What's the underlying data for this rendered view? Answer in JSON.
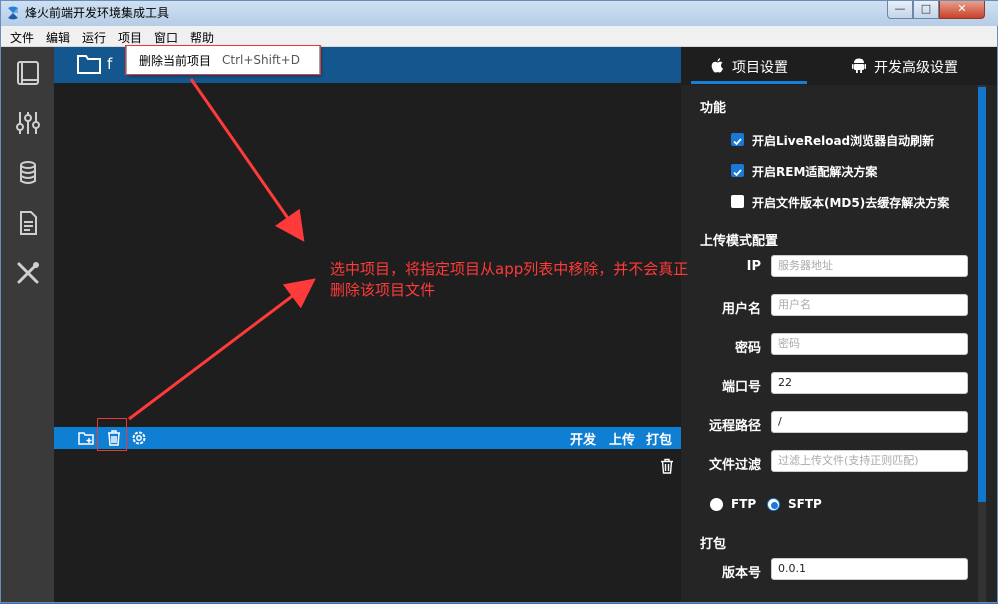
{
  "window": {
    "title": "烽火前端开发环境集成工具",
    "controls": {
      "minimize": "—",
      "maximize": "□",
      "close": "✕"
    }
  },
  "menubar": [
    "文件",
    "编辑",
    "运行",
    "项目",
    "窗口",
    "帮助"
  ],
  "sidebar": {
    "icons": [
      "book-icon",
      "sliders-icon",
      "database-icon",
      "document-icon",
      "tools-icon"
    ]
  },
  "project": {
    "name_visible": "f"
  },
  "dropdown": {
    "item": "删除当前项目",
    "shortcut": "Ctrl+Shift+D"
  },
  "toolbar": {
    "icons": [
      "add-folder-icon",
      "trash-icon",
      "gear-icon"
    ],
    "actions": [
      "开发",
      "上传",
      "打包"
    ]
  },
  "annotation": {
    "text": "选中项目，将指定项目从app列表中移除，并不会真正删除该项目文件"
  },
  "right_panel": {
    "tabs": [
      "项目设置",
      "开发高级设置"
    ],
    "sections": {
      "feature": "功能",
      "upload": "上传模式配置",
      "pack": "打包"
    },
    "checkboxes": [
      {
        "label": "开启LiveReload浏览器自动刷新",
        "checked": true
      },
      {
        "label": "开启REM适配解决方案",
        "checked": true
      },
      {
        "label": "开启文件版本(MD5)去缓存解决方案",
        "checked": false
      }
    ],
    "fields": [
      {
        "label": "IP",
        "value": "",
        "placeholder": "服务器地址"
      },
      {
        "label": "用户名",
        "value": "",
        "placeholder": "用户名"
      },
      {
        "label": "密码",
        "value": "",
        "placeholder": "密码"
      },
      {
        "label": "端口号",
        "value": "22",
        "placeholder": ""
      },
      {
        "label": "远程路径",
        "value": "/",
        "placeholder": ""
      },
      {
        "label": "文件过滤",
        "value": "",
        "placeholder": "过滤上传文件(支持正则匹配)"
      }
    ],
    "protocols": [
      {
        "label": "FTP",
        "selected": false
      },
      {
        "label": "SFTP",
        "selected": true
      }
    ],
    "version": {
      "label": "版本号",
      "value": "0.0.1"
    }
  },
  "colors": {
    "accent": "#0f7fd3",
    "project_bar": "#14578e",
    "annotation": "#ff3a3a",
    "panel_bg": "#252526",
    "editor_bg": "#1e1e1e"
  }
}
